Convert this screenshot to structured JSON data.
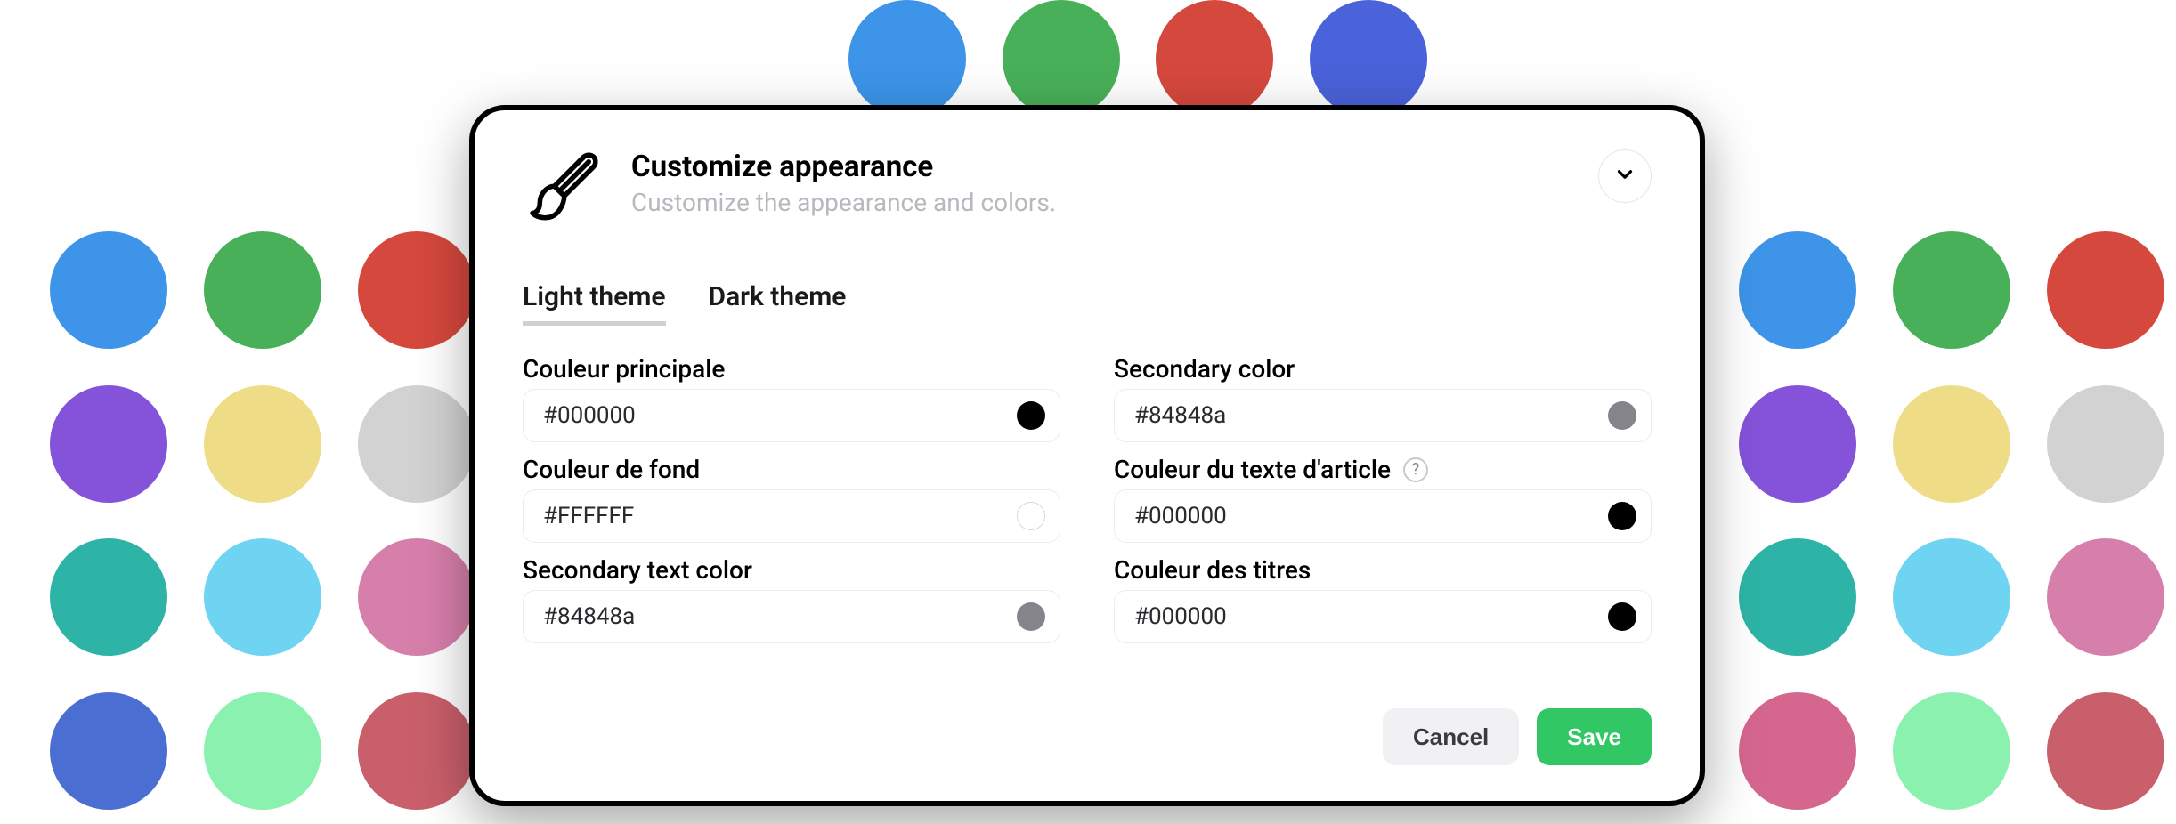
{
  "header": {
    "title": "Customize appearance",
    "subtitle": "Customize the appearance and colors."
  },
  "tabs": {
    "light": "Light theme",
    "dark": "Dark theme"
  },
  "fields": {
    "primary": {
      "label": "Couleur principale",
      "value": "#000000",
      "swatch": "#000000"
    },
    "secondary": {
      "label": "Secondary color",
      "value": "#84848a",
      "swatch": "#84848a"
    },
    "bg": {
      "label": "Couleur de fond",
      "value": "#FFFFFF",
      "swatch": "#FFFFFF"
    },
    "article": {
      "label": "Couleur du texte d'article",
      "value": "#000000",
      "swatch": "#000000",
      "help": "?"
    },
    "sectext": {
      "label": "Secondary text color",
      "value": "#84848a",
      "swatch": "#84848a"
    },
    "titles": {
      "label": "Couleur des titres",
      "value": "#000000",
      "swatch": "#000000"
    }
  },
  "buttons": {
    "cancel": "Cancel",
    "save": "Save"
  },
  "bg_dots": {
    "top": [
      "#3d94e8",
      "#48b058",
      "#d5483d",
      "#4a62da"
    ],
    "rows": [
      [
        "#3d94e8",
        "#48b058",
        "#d5483d",
        "#3d94e8",
        "#48b058",
        "#d5483d",
        "#4a62da"
      ],
      [
        "#8453d9",
        "#efdc87",
        "#d2d2d2",
        "#8453d9",
        "#efdc87",
        "#d2d2d2",
        "#3f3f3f"
      ],
      [
        "#2db4a6",
        "#6ed4f1",
        "#d77fab",
        "#2db4a6",
        "#6ed4f1",
        "#d77fab",
        "#dfa84a"
      ],
      [
        "#4a6ed2",
        "#8af1ae",
        "#c95f6a",
        "#d5668e",
        "#8af1ae",
        "#c95f6a",
        "#5a9fd1"
      ]
    ]
  }
}
